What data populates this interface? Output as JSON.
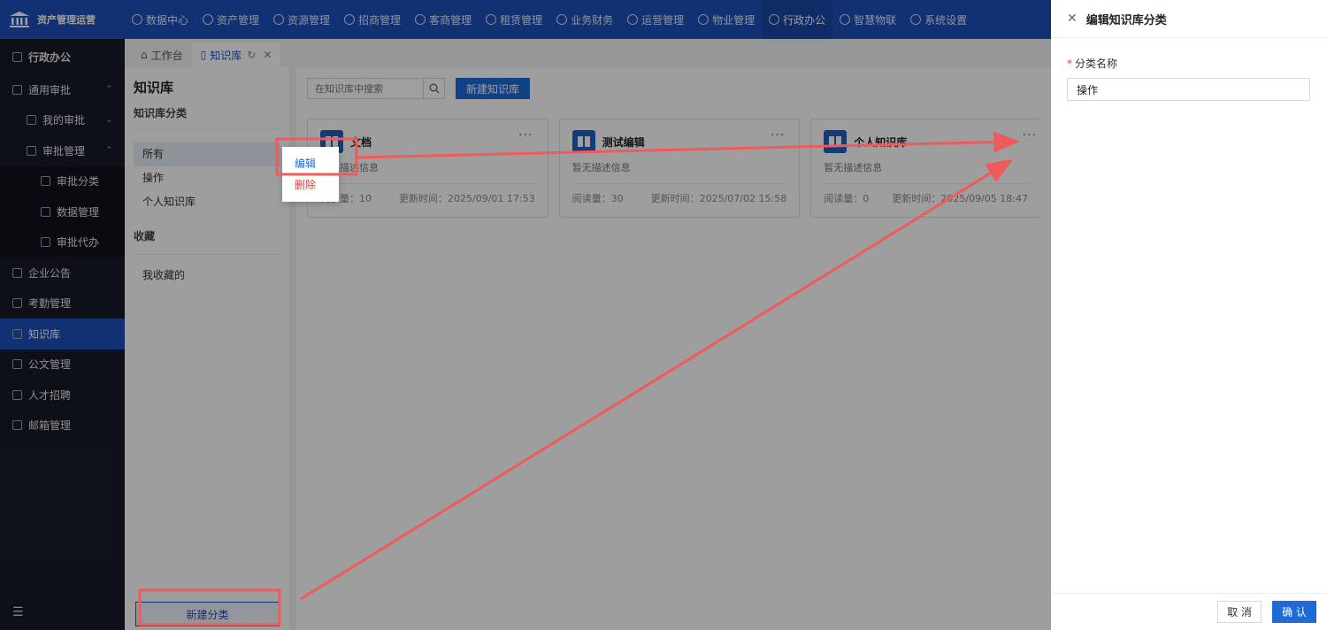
{
  "app": {
    "title": "资产管理运营"
  },
  "nav": [
    {
      "label": "数据中心",
      "icon": "dashboard-icon"
    },
    {
      "label": "资产管理",
      "icon": "cube-icon"
    },
    {
      "label": "资源管理",
      "icon": "building-icon"
    },
    {
      "label": "招商管理",
      "icon": "tag-icon"
    },
    {
      "label": "客商管理",
      "icon": "users-icon"
    },
    {
      "label": "租赁管理",
      "icon": "home-icon"
    },
    {
      "label": "业务财务",
      "icon": "money-icon"
    },
    {
      "label": "运营管理",
      "icon": "chart-icon"
    },
    {
      "label": "物业管理",
      "icon": "house-icon"
    },
    {
      "label": "行政办公",
      "icon": "monitor-icon",
      "active": true
    },
    {
      "label": "智慧物联",
      "icon": "iot-icon"
    },
    {
      "label": "系统设置",
      "icon": "settings-icon"
    }
  ],
  "sidebar": {
    "title": "行政办公",
    "items": [
      {
        "label": "通用审批",
        "chev": "⌃"
      },
      {
        "label": "我的审批",
        "chev": "⌄"
      },
      {
        "label": "审批管理",
        "chev": "⌃"
      },
      {
        "label": "审批分类"
      },
      {
        "label": "数据管理"
      },
      {
        "label": "审批代办"
      },
      {
        "label": "企业公告"
      },
      {
        "label": "考勤管理"
      },
      {
        "label": "知识库"
      },
      {
        "label": "公文管理"
      },
      {
        "label": "人才招聘"
      },
      {
        "label": "邮箱管理"
      }
    ]
  },
  "tabs": [
    {
      "label": "工作台"
    },
    {
      "label": "知识库"
    }
  ],
  "category_panel": {
    "title": "知识库",
    "subtitle": "知识库分类",
    "categories": [
      "所有",
      "操作",
      "个人知识库"
    ],
    "favorites_title": "收藏",
    "favorites": [
      "我收藏的"
    ],
    "new_button": "新建分类"
  },
  "toolbar": {
    "search_placeholder": "在知识库中搜索",
    "new_button": "新建知识库"
  },
  "cards": [
    {
      "title": "文档",
      "desc": "暂无描述信息",
      "reads": "阅读量：10",
      "updated": "更新时间：2025/09/01 17:53"
    },
    {
      "title": "测试编辑",
      "desc": "暂无描述信息",
      "reads": "阅读量：30",
      "updated": "更新时间：2025/07/02 15:58"
    },
    {
      "title": "个人知识库",
      "desc": "暂无描述信息",
      "reads": "阅读量：0",
      "updated": "更新时间：2025/09/05 18:47"
    }
  ],
  "context_menu": {
    "edit": "编辑",
    "delete": "删除"
  },
  "drawer": {
    "title": "编辑知识库分类",
    "field_label": "分类名称",
    "field_value": "操作",
    "cancel": "取 消",
    "confirm": "确 认"
  },
  "colors": {
    "primary": "#1e4fb8",
    "button": "#1e6ad8",
    "annotation": "#f05a5a",
    "danger": "#e04040"
  }
}
